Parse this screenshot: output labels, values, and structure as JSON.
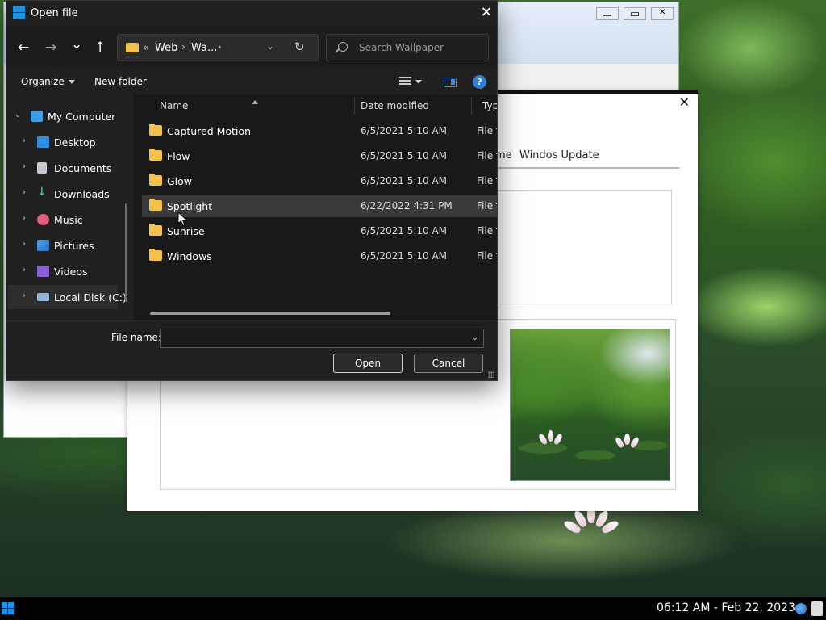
{
  "dialog": {
    "title": "Open file",
    "close_glyph": "✕",
    "nav": {
      "back": "←",
      "forward": "→",
      "recent": "⌄",
      "up": "↑",
      "refresh": "↻"
    },
    "address": {
      "prefix": "«",
      "crumbs": [
        "Web",
        "Wa..."
      ],
      "separator": "›",
      "dropdown": "⌄"
    },
    "search": {
      "placeholder": "Search Wallpaper"
    },
    "toolbar": {
      "organize": "Organize",
      "new_folder": "New folder",
      "help": "?"
    },
    "tree": [
      {
        "label": "My Computer",
        "expanded": true
      },
      {
        "label": "Desktop"
      },
      {
        "label": "Documents"
      },
      {
        "label": "Downloads"
      },
      {
        "label": "Music"
      },
      {
        "label": "Pictures"
      },
      {
        "label": "Videos"
      },
      {
        "label": "Local Disk (C:)",
        "selected": true
      }
    ],
    "columns": {
      "name": "Name",
      "date": "Date modified",
      "type": "Type"
    },
    "files": [
      {
        "name": "Captured Motion",
        "date": "6/5/2021 5:10 AM",
        "type": "File fo"
      },
      {
        "name": "Flow",
        "date": "6/5/2021 5:10 AM",
        "type": "File fo"
      },
      {
        "name": "Glow",
        "date": "6/5/2021 5:10 AM",
        "type": "File fo"
      },
      {
        "name": "Spotlight",
        "date": "6/22/2022 4:31 PM",
        "type": "File fo",
        "hover": true
      },
      {
        "name": "Sunrise",
        "date": "6/5/2021 5:10 AM",
        "type": "File fo"
      },
      {
        "name": "Windows",
        "date": "6/5/2021 5:10 AM",
        "type": "File fo"
      }
    ],
    "footer": {
      "file_name_label": "File name:",
      "file_name_value": "",
      "open": "Open",
      "cancel": "Cancel"
    }
  },
  "settings_window": {
    "close_glyph": "✕",
    "tabs": [
      "ramme",
      "Windos Update"
    ]
  },
  "taskbar": {
    "clock": "06:12 AM - Feb 22, 2023"
  },
  "colors": {
    "dialog_bg": "#202020",
    "folder": "#f2c14e",
    "accent": "#1e90e6"
  }
}
